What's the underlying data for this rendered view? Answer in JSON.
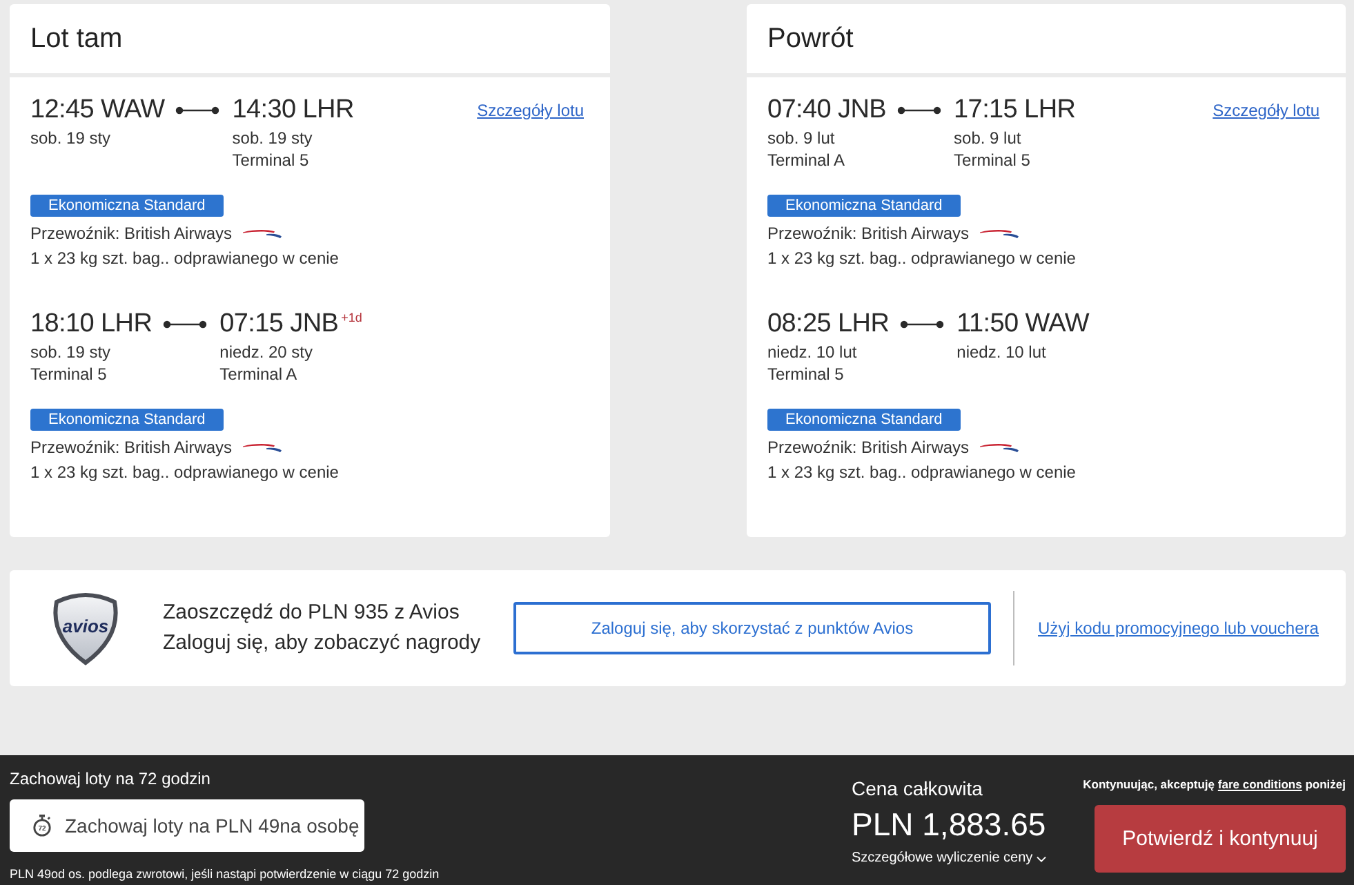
{
  "journeys": [
    {
      "title": "Lot tam",
      "segments": [
        {
          "departure": {
            "time": "12:45 WAW",
            "date": "sob. 19 sty"
          },
          "arrival": {
            "time": "14:30 LHR",
            "date": "sob. 19 sty",
            "terminal": "Terminal 5"
          },
          "details_link": "Szczegóły lotu",
          "fare_badge": "Ekonomiczna Standard",
          "carrier": "Przewoźnik: British Airways",
          "baggage": "1 x 23 kg szt. bag.. odprawianego w cenie"
        },
        {
          "departure": {
            "time": "18:10 LHR",
            "date": "sob. 19 sty",
            "terminal": "Terminal 5"
          },
          "arrival": {
            "time": "07:15 JNB",
            "day_offset": "+1d",
            "date": "niedz. 20 sty",
            "terminal": "Terminal A"
          },
          "fare_badge": "Ekonomiczna Standard",
          "carrier": "Przewoźnik: British Airways",
          "baggage": "1 x 23 kg szt. bag.. odprawianego w cenie"
        }
      ]
    },
    {
      "title": "Powrót",
      "segments": [
        {
          "departure": {
            "time": "07:40 JNB",
            "date": "sob. 9 lut",
            "terminal": "Terminal A"
          },
          "arrival": {
            "time": "17:15 LHR",
            "date": "sob. 9 lut",
            "terminal": "Terminal 5"
          },
          "details_link": "Szczegóły lotu",
          "fare_badge": "Ekonomiczna Standard",
          "carrier": "Przewoźnik: British Airways",
          "baggage": "1 x 23 kg szt. bag.. odprawianego w cenie"
        },
        {
          "departure": {
            "time": "08:25 LHR",
            "date": "niedz. 10 lut",
            "terminal": "Terminal 5"
          },
          "arrival": {
            "time": "11:50 WAW",
            "date": "niedz. 10 lut"
          },
          "fare_badge": "Ekonomiczna Standard",
          "carrier": "Przewoźnik: British Airways",
          "baggage": "1 x 23 kg szt. bag.. odprawianego w cenie"
        }
      ]
    }
  ],
  "avios": {
    "logo_text": "avios",
    "headline": "Zaoszczędź do PLN 935 z Avios",
    "subline": "Zaloguj się, aby zobaczyć nagrody",
    "login_button": "Zaloguj się, aby skorzystać z punktów Avios",
    "promo_link": "Użyj kodu promocyjnego lub vouchera"
  },
  "footer": {
    "hold_title": "Zachowaj loty na 72 godzin",
    "hold_button": {
      "icon_label": "72",
      "label": "Zachowaj loty na PLN 49na osobę"
    },
    "hold_note": "PLN 49od os. podlega zwrotowi, jeśli nastąpi potwierdzenie w ciągu 72 godzin",
    "price_label": "Cena całkowita",
    "price": "PLN 1,883.65",
    "price_details": "Szczegółowe wyliczenie ceny",
    "terms": {
      "before": "Kontynuując, akceptuję",
      "link": "fare conditions",
      "after": "poniżej"
    },
    "confirm_button": "Potwierdź i kontynuuj"
  }
}
